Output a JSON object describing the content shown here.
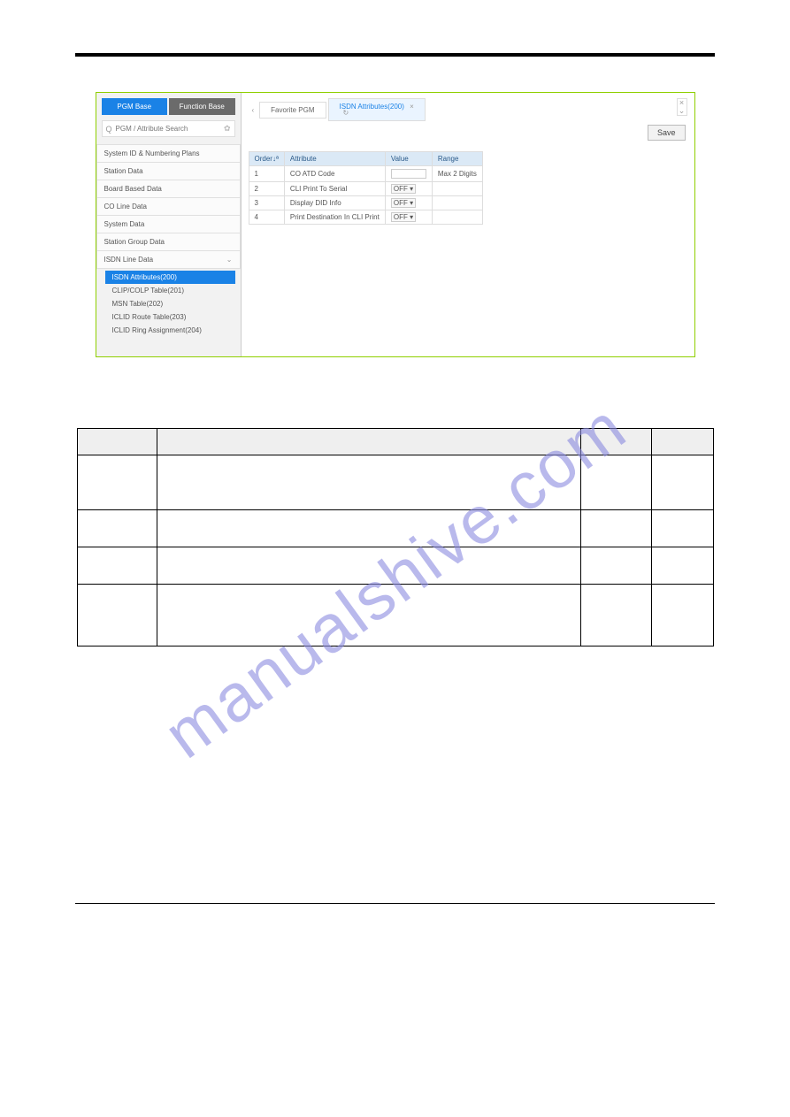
{
  "watermark": "manualshive.com",
  "left_panel": {
    "tabs": {
      "pgm_base": "PGM Base",
      "function_base": "Function Base"
    },
    "search_placeholder": "PGM / Attribute Search",
    "menu": {
      "system_id": "System ID & Numbering Plans",
      "station_data": "Station Data",
      "board_based": "Board Based Data",
      "co_line": "CO Line Data",
      "system_data": "System Data",
      "station_group": "Station Group Data",
      "isdn_line": "ISDN Line Data"
    },
    "sub": {
      "isdn_attr": "ISDN Attributes(200)",
      "clip_colp": "CLIP/COLP Table(201)",
      "msn_table": "MSN Table(202)",
      "iclid_route": "ICLID Route Table(203)",
      "iclid_ring": "ICLID Ring Assignment(204)"
    }
  },
  "right_panel": {
    "tab_fav": "Favorite PGM",
    "tab_active": "ISDN Attributes(200)",
    "save": "Save",
    "headers": {
      "order": "Order↓ª",
      "attribute": "Attribute",
      "value": "Value",
      "range": "Range"
    },
    "rows": [
      {
        "n": "1",
        "attr": "CO ATD Code",
        "value": "",
        "range": "Max 2 Digits",
        "type": "input"
      },
      {
        "n": "2",
        "attr": "CLI Print To Serial",
        "value": "OFF",
        "range": "",
        "type": "select"
      },
      {
        "n": "3",
        "attr": "Display DID Info",
        "value": "OFF",
        "range": "",
        "type": "select"
      },
      {
        "n": "4",
        "attr": "Print Destination In CLI Print",
        "value": "OFF",
        "range": "",
        "type": "select"
      }
    ]
  },
  "doc_table": {
    "headers": {
      "c1": "",
      "c2": "",
      "c3": "",
      "c4": ""
    },
    "rows": [
      {
        "c1": "",
        "c2": "",
        "c3": "",
        "c4": ""
      },
      {
        "c1": "",
        "c2": "",
        "c3": "",
        "c4": ""
      },
      {
        "c1": "",
        "c2": "",
        "c3": "",
        "c4": ""
      },
      {
        "c1": "",
        "c2": "",
        "c3": "",
        "c4": ""
      }
    ]
  }
}
